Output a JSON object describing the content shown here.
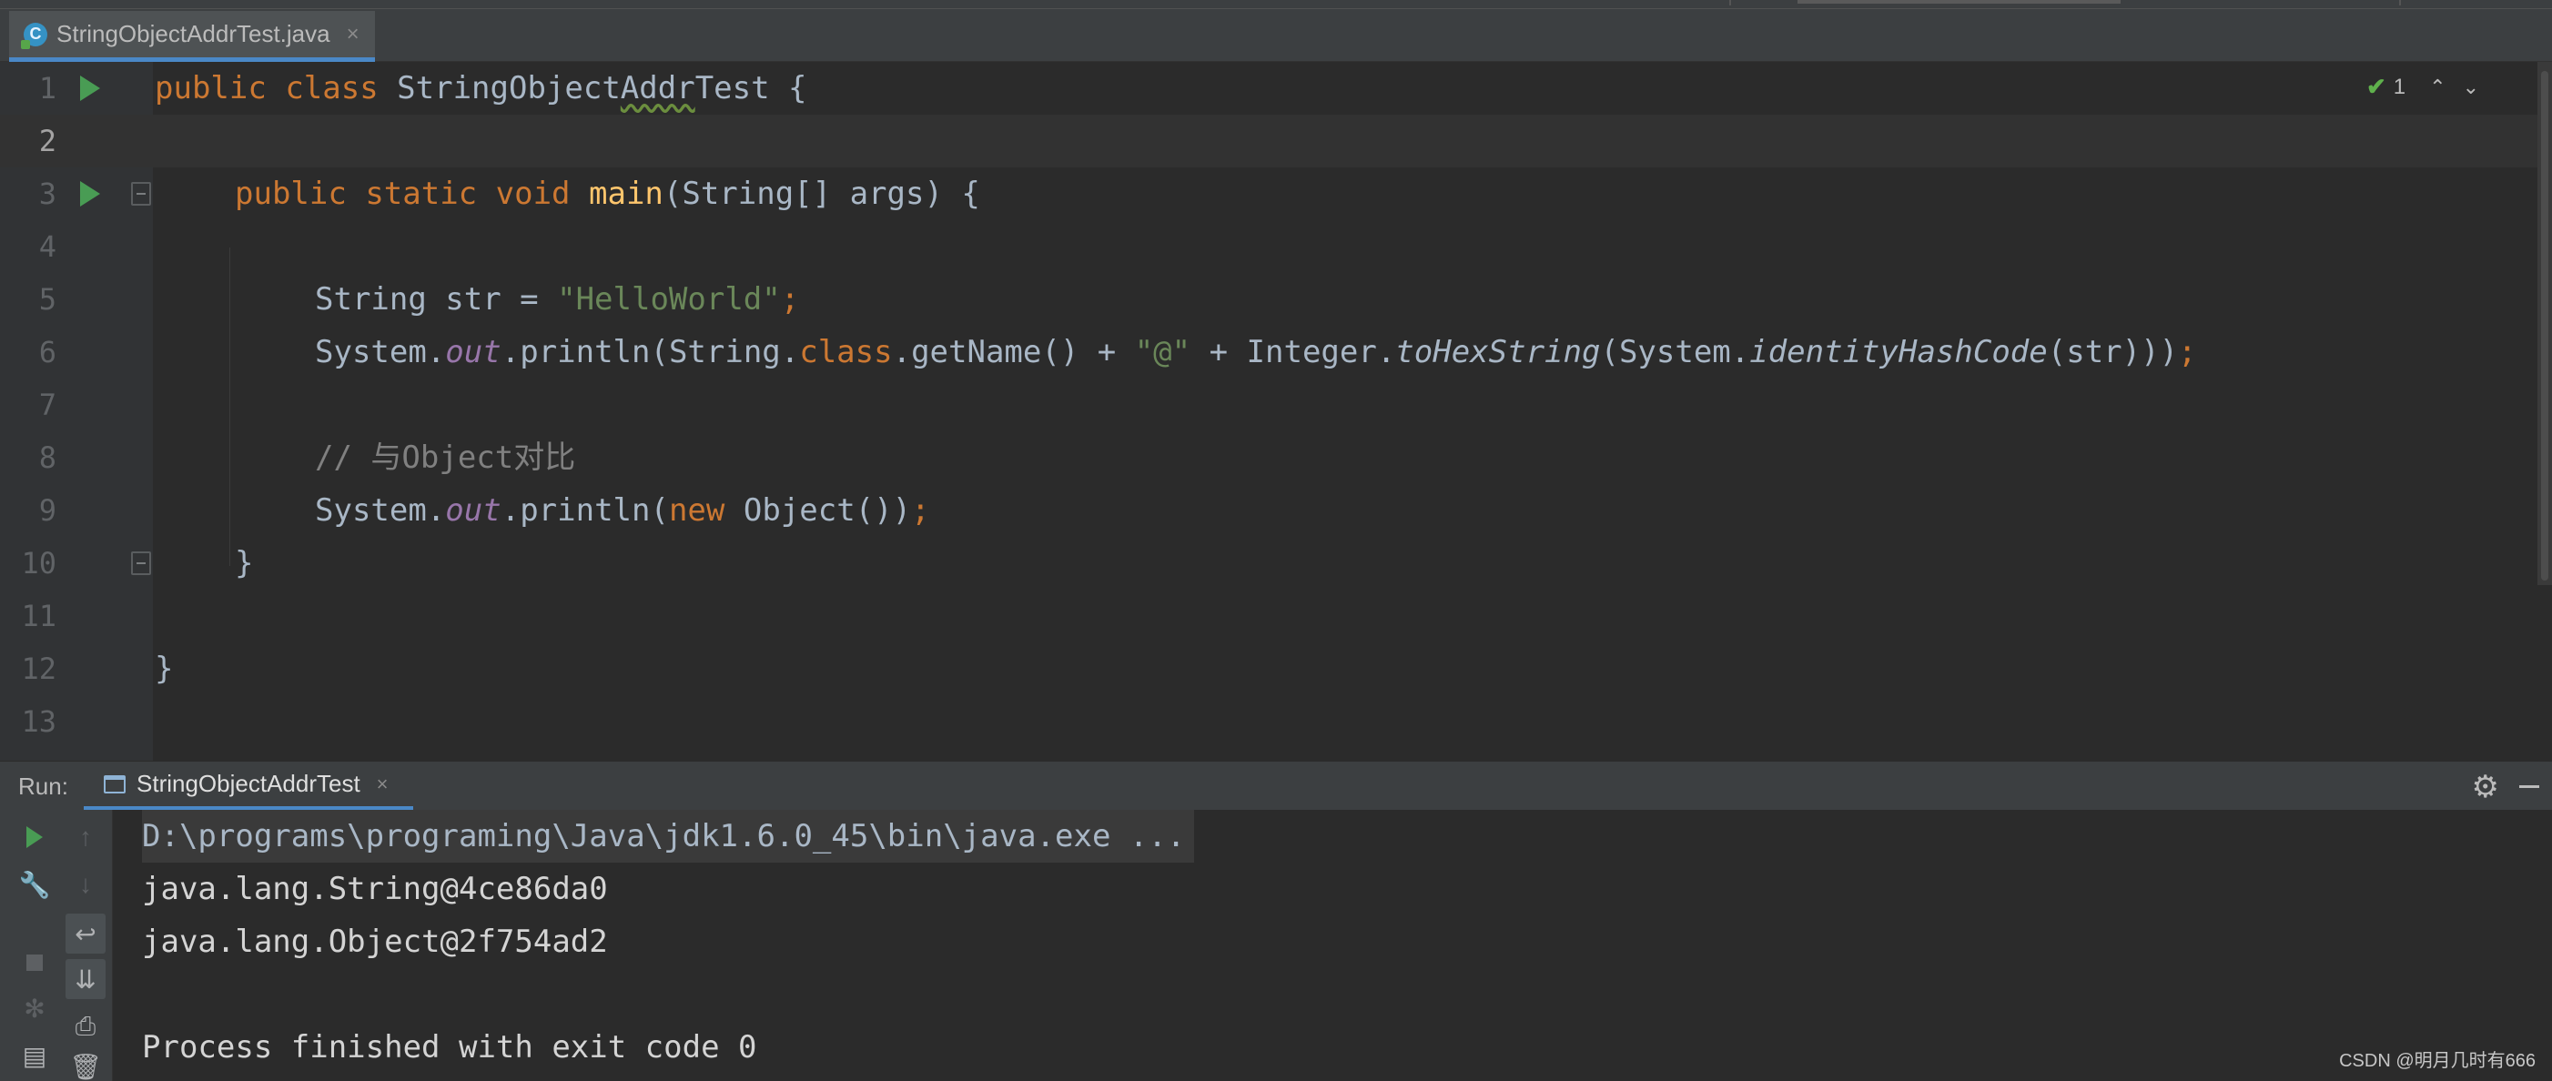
{
  "editor": {
    "file_tab": {
      "label": "StringObjectAddrTest.java",
      "close_glyph": "×",
      "icon": "java-class-icon",
      "icon_letter": "C"
    },
    "inspection": {
      "icon": "check-icon",
      "count": "1"
    },
    "lines": [
      {
        "number": "1"
      },
      {
        "number": "2"
      },
      {
        "number": "3"
      },
      {
        "number": "4"
      },
      {
        "number": "5"
      },
      {
        "number": "6"
      },
      {
        "number": "7"
      },
      {
        "number": "8"
      },
      {
        "number": "9"
      },
      {
        "number": "10"
      },
      {
        "number": "11"
      },
      {
        "number": "12"
      },
      {
        "number": "13"
      }
    ],
    "code": {
      "l1": {
        "kw1": "public",
        "kw2": "class",
        "name_pre": "StringObject",
        "name_typo": "Addr",
        "name_post": "Test",
        "brace": " {"
      },
      "l3": {
        "kw1": "public",
        "kw2": "static",
        "kw3": "void",
        "method": "main",
        "params": "(String[] args) {"
      },
      "l5": {
        "type": "String str = ",
        "literal": "\"HelloWorld\"",
        "semi": ";"
      },
      "l6": {
        "p1": "System.",
        "field": "out",
        "p2": ".println(String.",
        "kw": "class",
        "p3": ".getName() + ",
        "literal": "\"@\"",
        "p4": " + Integer.",
        "static1": "toHexString",
        "p5": "(System.",
        "static2": "identityHashCode",
        "p6": "(str)))",
        "semi": ";"
      },
      "l8": {
        "comment": "// 与Object对比"
      },
      "l9": {
        "p1": "System.",
        "field": "out",
        "p2": ".println(",
        "kw": "new",
        "p3": " Object())",
        "semi": ";"
      },
      "l10": {
        "brace": "}"
      },
      "l12": {
        "brace": "}"
      }
    }
  },
  "run_panel": {
    "title": "Run:",
    "tab_label": "StringObjectAddrTest",
    "tab_close": "×",
    "console": {
      "command": "D:\\programs\\programing\\Java\\jdk1.6.0_45\\bin\\java.exe ...",
      "output_1": "java.lang.String@4ce86da0",
      "output_2": "java.lang.Object@2f754ad2",
      "exit": "Process finished with exit code 0"
    }
  },
  "watermark": "CSDN @明月几时有666",
  "colors": {
    "background": "#2b2b2b",
    "keyword": "#cc7832",
    "string": "#6a8759",
    "field": "#9876aa",
    "method": "#ffc66d",
    "comment": "#808080",
    "run_green": "#499c54",
    "accent_blue": "#4a88c7"
  }
}
